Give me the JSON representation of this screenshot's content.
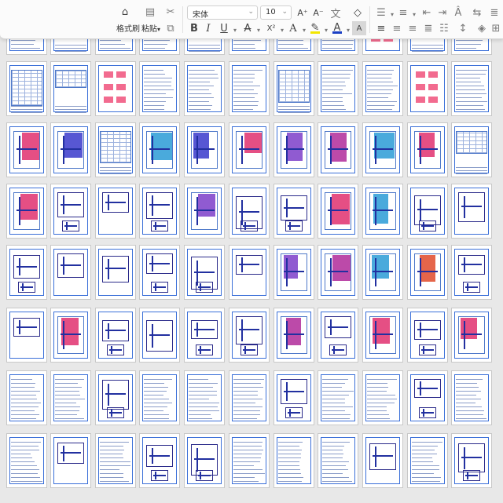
{
  "toolbar": {
    "format_painter_label": "格式刷",
    "paste_label": "粘贴",
    "paste_caret": "▾",
    "font_name": "宋体",
    "font_size": "10",
    "grow_font": "A⁺",
    "shrink_font": "A⁻",
    "clear_format": "◇",
    "bold": "B",
    "italic": "I",
    "underline": "U",
    "strikethrough": "A",
    "superscript": "X²",
    "text_effect": "A",
    "highlight": "✎",
    "font_color": "A",
    "char_shading": "A",
    "highlight_color": "#f3e600",
    "font_color_value": "#1a3fc4",
    "dropdown_caret": "▾"
  },
  "document": {
    "view": "page-thumbnails",
    "rows": 8,
    "columns": 11
  }
}
